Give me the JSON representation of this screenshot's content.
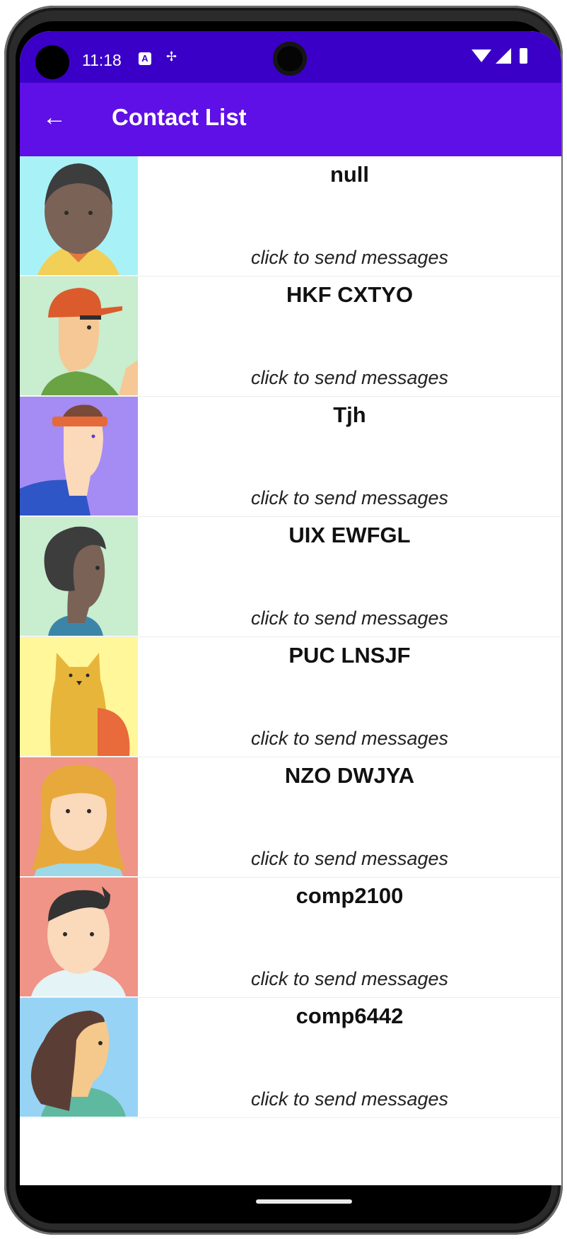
{
  "status_bar": {
    "time": "11:18",
    "notification_icons": [
      "a-icon",
      "usb-debug-icon"
    ],
    "system_icons": [
      "wifi-icon",
      "cell-signal-icon",
      "battery-icon"
    ]
  },
  "appbar": {
    "title": "Contact List",
    "back_icon": "arrow-left-icon"
  },
  "contacts": [
    {
      "name": "null",
      "subtitle": "click to send messages"
    },
    {
      "name": "HKF CXTYO",
      "subtitle": "click to send messages"
    },
    {
      "name": "Tjh",
      "subtitle": "click to send messages"
    },
    {
      "name": "UIX EWFGL",
      "subtitle": "click to send messages"
    },
    {
      "name": "PUC LNSJF",
      "subtitle": "click to send messages"
    },
    {
      "name": "NZO DWJYA",
      "subtitle": "click to send messages"
    },
    {
      "name": "comp2100",
      "subtitle": "click to send messages"
    },
    {
      "name": "comp6442",
      "subtitle": "click to send messages"
    }
  ],
  "colors": {
    "status_bar": "#3b00c7",
    "app_bar": "#5f10e6",
    "avatar_backgrounds": [
      "#a8f2f7",
      "#c8edcf",
      "#a58bf4",
      "#c8edcf",
      "#fff79a",
      "#ef9486",
      "#ef9486",
      "#97d3f5"
    ]
  }
}
